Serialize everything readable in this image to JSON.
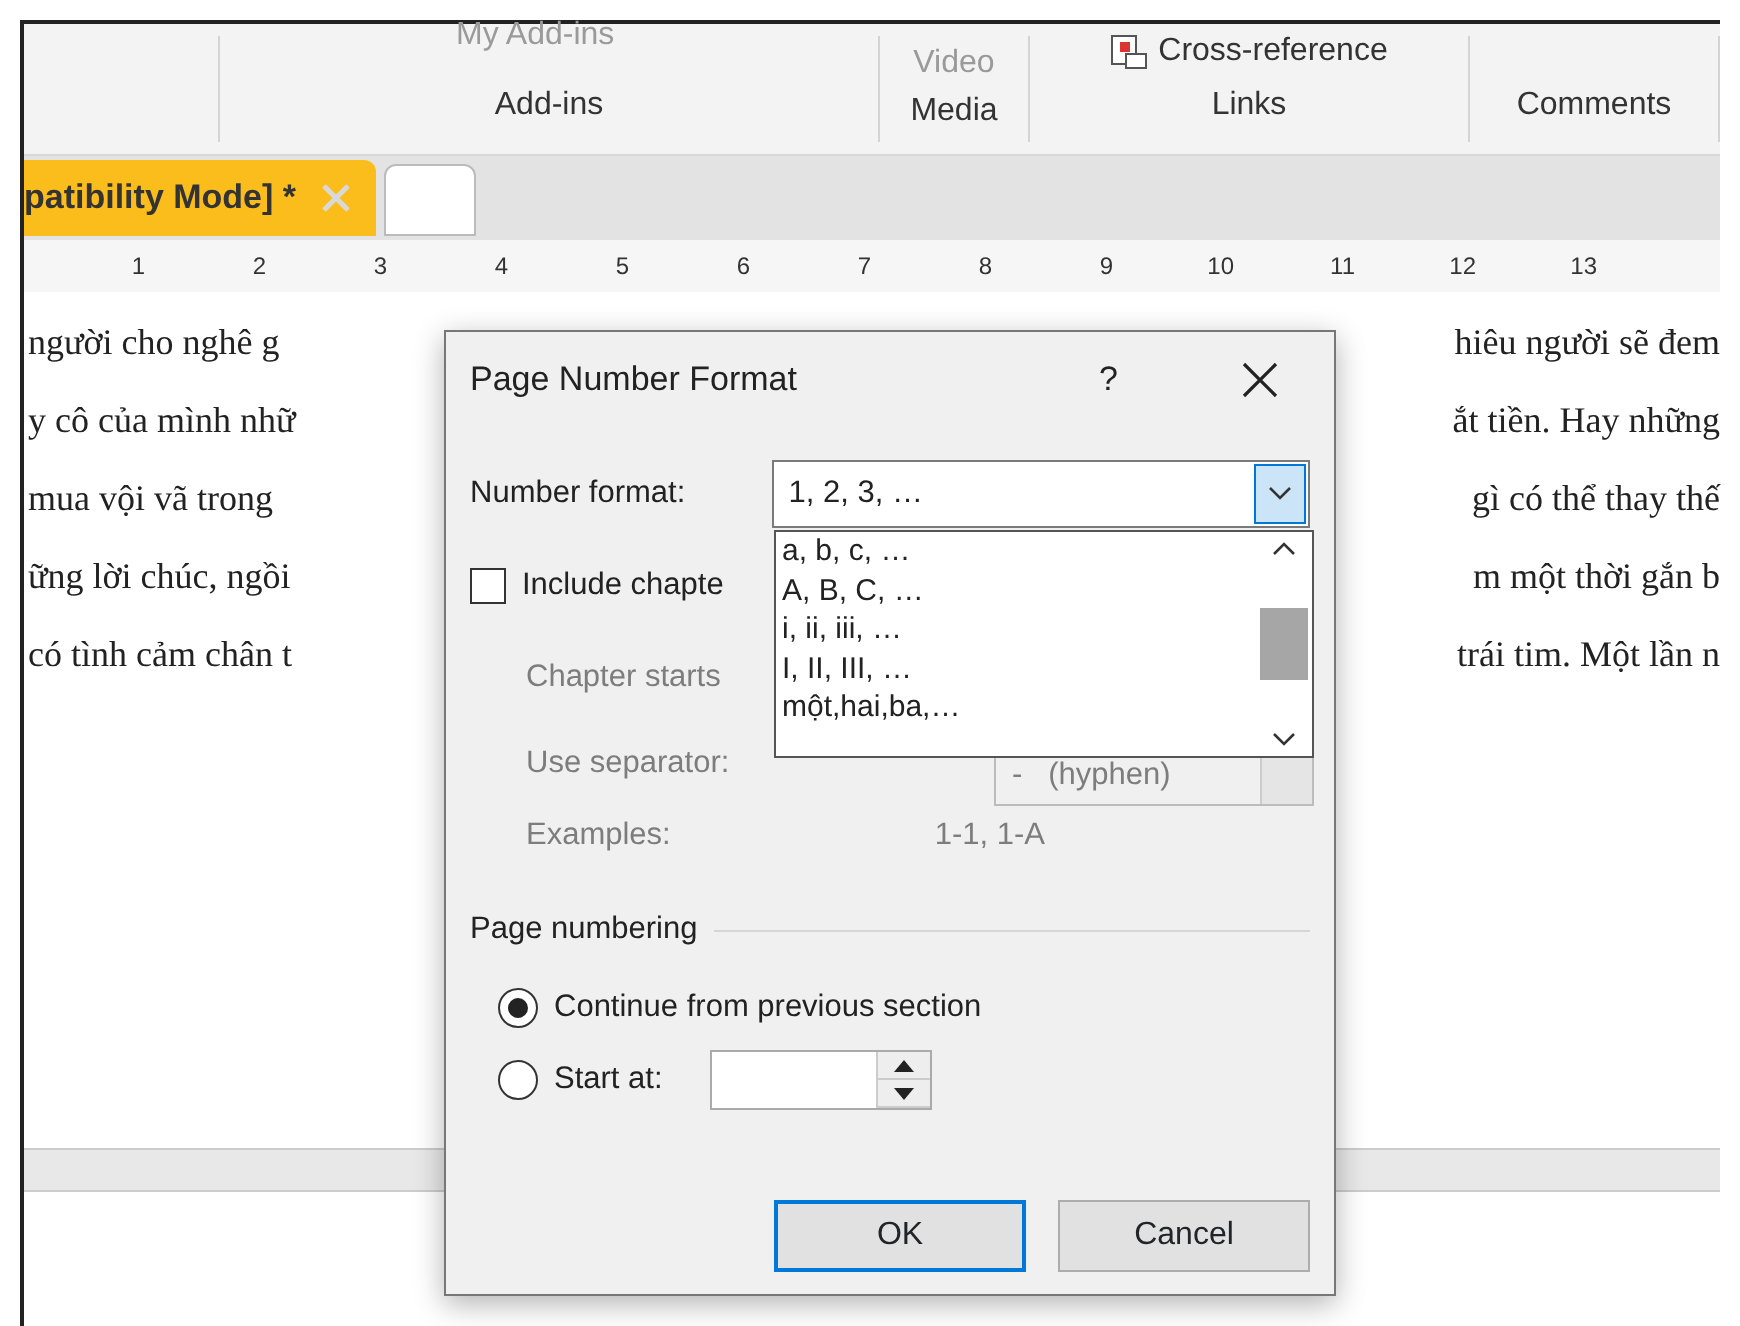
{
  "ribbon": {
    "partial_button": "My Add-ins",
    "video_button": "Video",
    "cross_reference_button": "Cross-reference",
    "groups": [
      "Add-ins",
      "Media",
      "Links",
      "Comments"
    ]
  },
  "document_tab": {
    "title": "patibility Mode] *",
    "selected": true
  },
  "ruler": [
    "1",
    "2",
    "3",
    "4",
    "5",
    "6",
    "7",
    "8",
    "9",
    "10",
    "11",
    "12",
    "13"
  ],
  "document": {
    "lines": [
      {
        "left": "người cho nghê g",
        "right": "hiêu người sẽ đem"
      },
      {
        "left": "y cô của mình nhữ",
        "right": "ắt tiền. Hay những"
      },
      {
        "left": "mua vội vã trong",
        "right": "gì có thể thay thế"
      },
      {
        "left": "ững lời chúc, ngồi",
        "right": "m một thời gắn b"
      },
      {
        "left": "có tình cảm chân t",
        "right": "trái tim. Một lần n"
      }
    ]
  },
  "dialog": {
    "title": "Page Number Format",
    "help": "?",
    "number_format": {
      "label": "Number format:",
      "value": "1, 2, 3, …",
      "expanded": true,
      "options": [
        {
          "label": "a, b, c, …",
          "selected": false
        },
        {
          "label": "A, B, C, …",
          "selected": false
        },
        {
          "label": "i, ii, iii, …",
          "selected": false
        },
        {
          "label": "I, II, III, …",
          "selected": false
        },
        {
          "label": "một,hai,ba,…",
          "selected": false
        }
      ]
    },
    "include_chapter": {
      "label": "Include chapte",
      "checked": false
    },
    "chapter_starts": {
      "label": "Chapter starts",
      "disabled": true
    },
    "separator": {
      "label": "Use separator:",
      "value": "-   (hyphen)",
      "disabled": true
    },
    "examples": {
      "label": "Examples:",
      "value": "1-1, 1-A",
      "disabled": true
    },
    "page_numbering": {
      "title": "Page numbering",
      "options": [
        {
          "label": "Continue from previous section",
          "selected": true
        },
        {
          "label": "Start at:",
          "selected": false
        }
      ]
    },
    "buttons": [
      {
        "label": "OK",
        "default": true
      },
      {
        "label": "Cancel",
        "default": false
      }
    ]
  }
}
